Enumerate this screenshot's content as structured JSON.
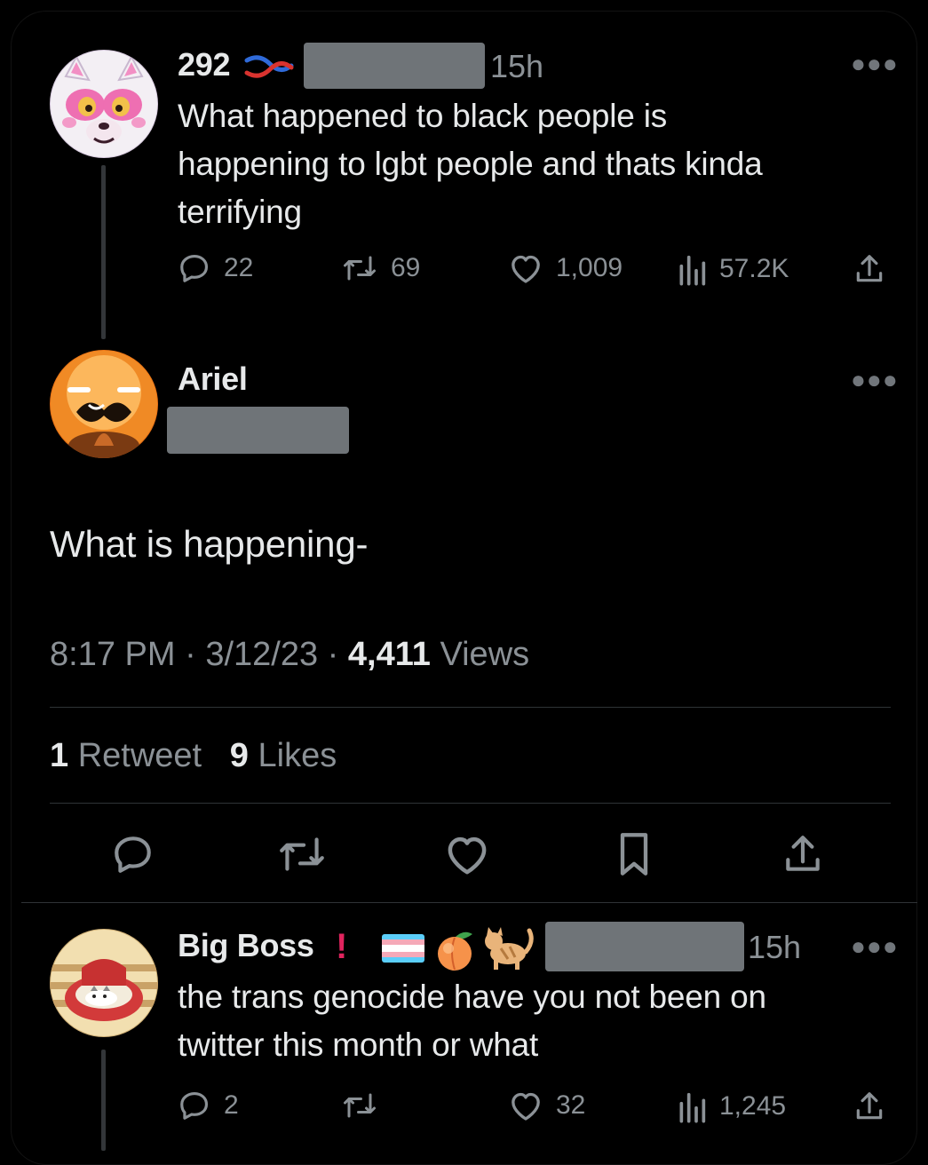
{
  "colors": {
    "background": "#000000",
    "text_primary": "#e7e9ea",
    "text_secondary": "#8b9196",
    "divider": "#2f3336",
    "verified_red": "#e0245e"
  },
  "tweet1": {
    "display_name": "292",
    "time": "15h",
    "text_line1": "What happened to black people is",
    "text_line2": "happening to lgbt people and thats kinda",
    "text_line3": "terrifying",
    "replies": "22",
    "retweets": "69",
    "likes": "1,009",
    "views": "57.2K"
  },
  "main_tweet": {
    "display_name": "Ariel",
    "text": "What is happening-",
    "time": "8:17 PM",
    "date": "3/12/23",
    "views_count": "4,411",
    "views_label": "Views",
    "retweet_count": "1",
    "retweet_label": "Retweet",
    "likes_count": "9",
    "likes_label": "Likes",
    "separator": "·"
  },
  "reply": {
    "display_name": "Big Boss",
    "badge": "!",
    "time": "15h",
    "text_line1": "the trans genocide have you not been on",
    "text_line2": "twitter this month or what",
    "replies": "2",
    "likes": "32",
    "views": "1,245"
  },
  "icons": {
    "more": "more-dots-icon",
    "reply": "reply-icon",
    "retweet": "retweet-icon",
    "like": "heart-icon",
    "views": "views-icon",
    "share": "share-icon",
    "bookmark": "bookmark-icon"
  }
}
